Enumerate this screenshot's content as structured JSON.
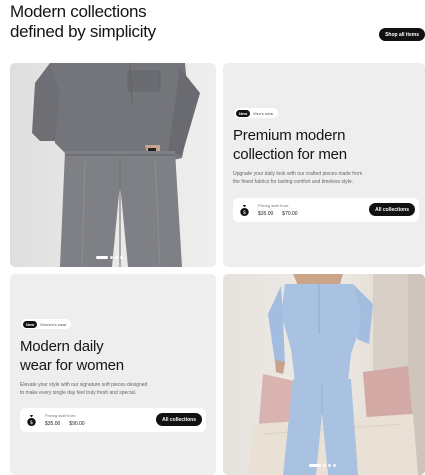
{
  "header": {
    "title_line1": "Modern collections",
    "title_line2": "defined by simplicity",
    "shop_button": "Shop all items"
  },
  "men": {
    "badge": "New",
    "category": "Men's wear",
    "title_line1": "Premium modern",
    "title_line2": "collection for men",
    "desc_line1": "Upgrade your daily look with our crafted pieces made from",
    "desc_line2": "the finest fabrics for lasting comfort and timeless style.",
    "price_label": "Pricing start from:",
    "price_low": "$35.00",
    "price_high": "$70.00",
    "button": "All collections"
  },
  "women": {
    "badge": "New",
    "category": "Women's wear",
    "title_line1": "Modern daily",
    "title_line2": "wear for women",
    "desc_line1": "Elevate your style with our signature soft pieces designed",
    "desc_line2": "to make every single day feel truly fresh and special.",
    "price_label": "Pricing start from:",
    "price_low": "$35.00",
    "price_high": "$90.00",
    "button": "All collections"
  }
}
